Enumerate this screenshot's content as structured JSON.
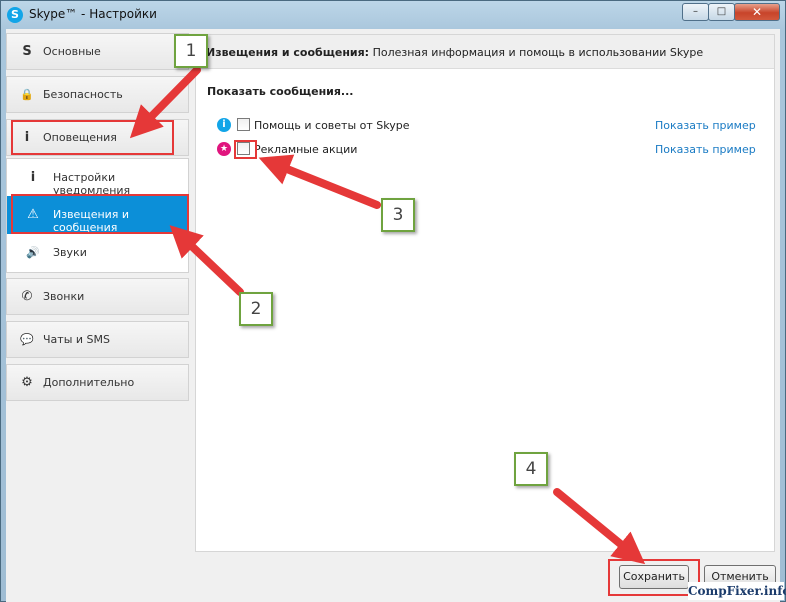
{
  "window": {
    "title": "Skype™ - Настройки",
    "app_icon": "S",
    "minimize": "–",
    "maximize": "□",
    "close": "✕"
  },
  "sidebar": {
    "items": [
      {
        "label": "Основные",
        "icon": "skype-icon",
        "glyph": "S"
      },
      {
        "label": "Безопасность",
        "icon": "lock-icon",
        "glyph": "🔒"
      },
      {
        "label": "Оповещения",
        "icon": "info-icon",
        "glyph": "i"
      },
      {
        "label": "Звонки",
        "icon": "phone-icon",
        "glyph": "✆"
      },
      {
        "label": "Чаты и SMS",
        "icon": "chat-icon",
        "glyph": "💬"
      },
      {
        "label": "Дополнительно",
        "icon": "gear-icon",
        "glyph": "⚙"
      }
    ],
    "subitems": [
      {
        "label": "Настройки уведомления",
        "icon": "info-icon",
        "glyph": "i"
      },
      {
        "label": "Извещения и сообщения",
        "icon": "warning-icon",
        "glyph": "⚠"
      },
      {
        "label": "Звуки",
        "icon": "speaker-icon",
        "glyph": "🔊"
      }
    ]
  },
  "content": {
    "header_title": "Извещения и сообщения:",
    "header_desc": "Полезная информация и помощь в использовании Skype",
    "section_title": "Показать сообщения...",
    "options": [
      {
        "label": "Помощь и советы от Skype",
        "link": "Показать пример",
        "icon": "info-icon",
        "glyph": "i",
        "color": "#12a5e8",
        "checked": false
      },
      {
        "label": "Рекламные акции",
        "link": "Показать пример",
        "icon": "star-icon",
        "glyph": "★",
        "color": "#e0157e",
        "checked": false
      }
    ]
  },
  "footer": {
    "save": "Сохранить",
    "cancel": "Отменить"
  },
  "annotations": {
    "n1": "1",
    "n2": "2",
    "n3": "3",
    "n4": "4",
    "highlight_color": "#e53838",
    "label_border": "#6fa33f"
  },
  "watermark": "CompFixer.info"
}
